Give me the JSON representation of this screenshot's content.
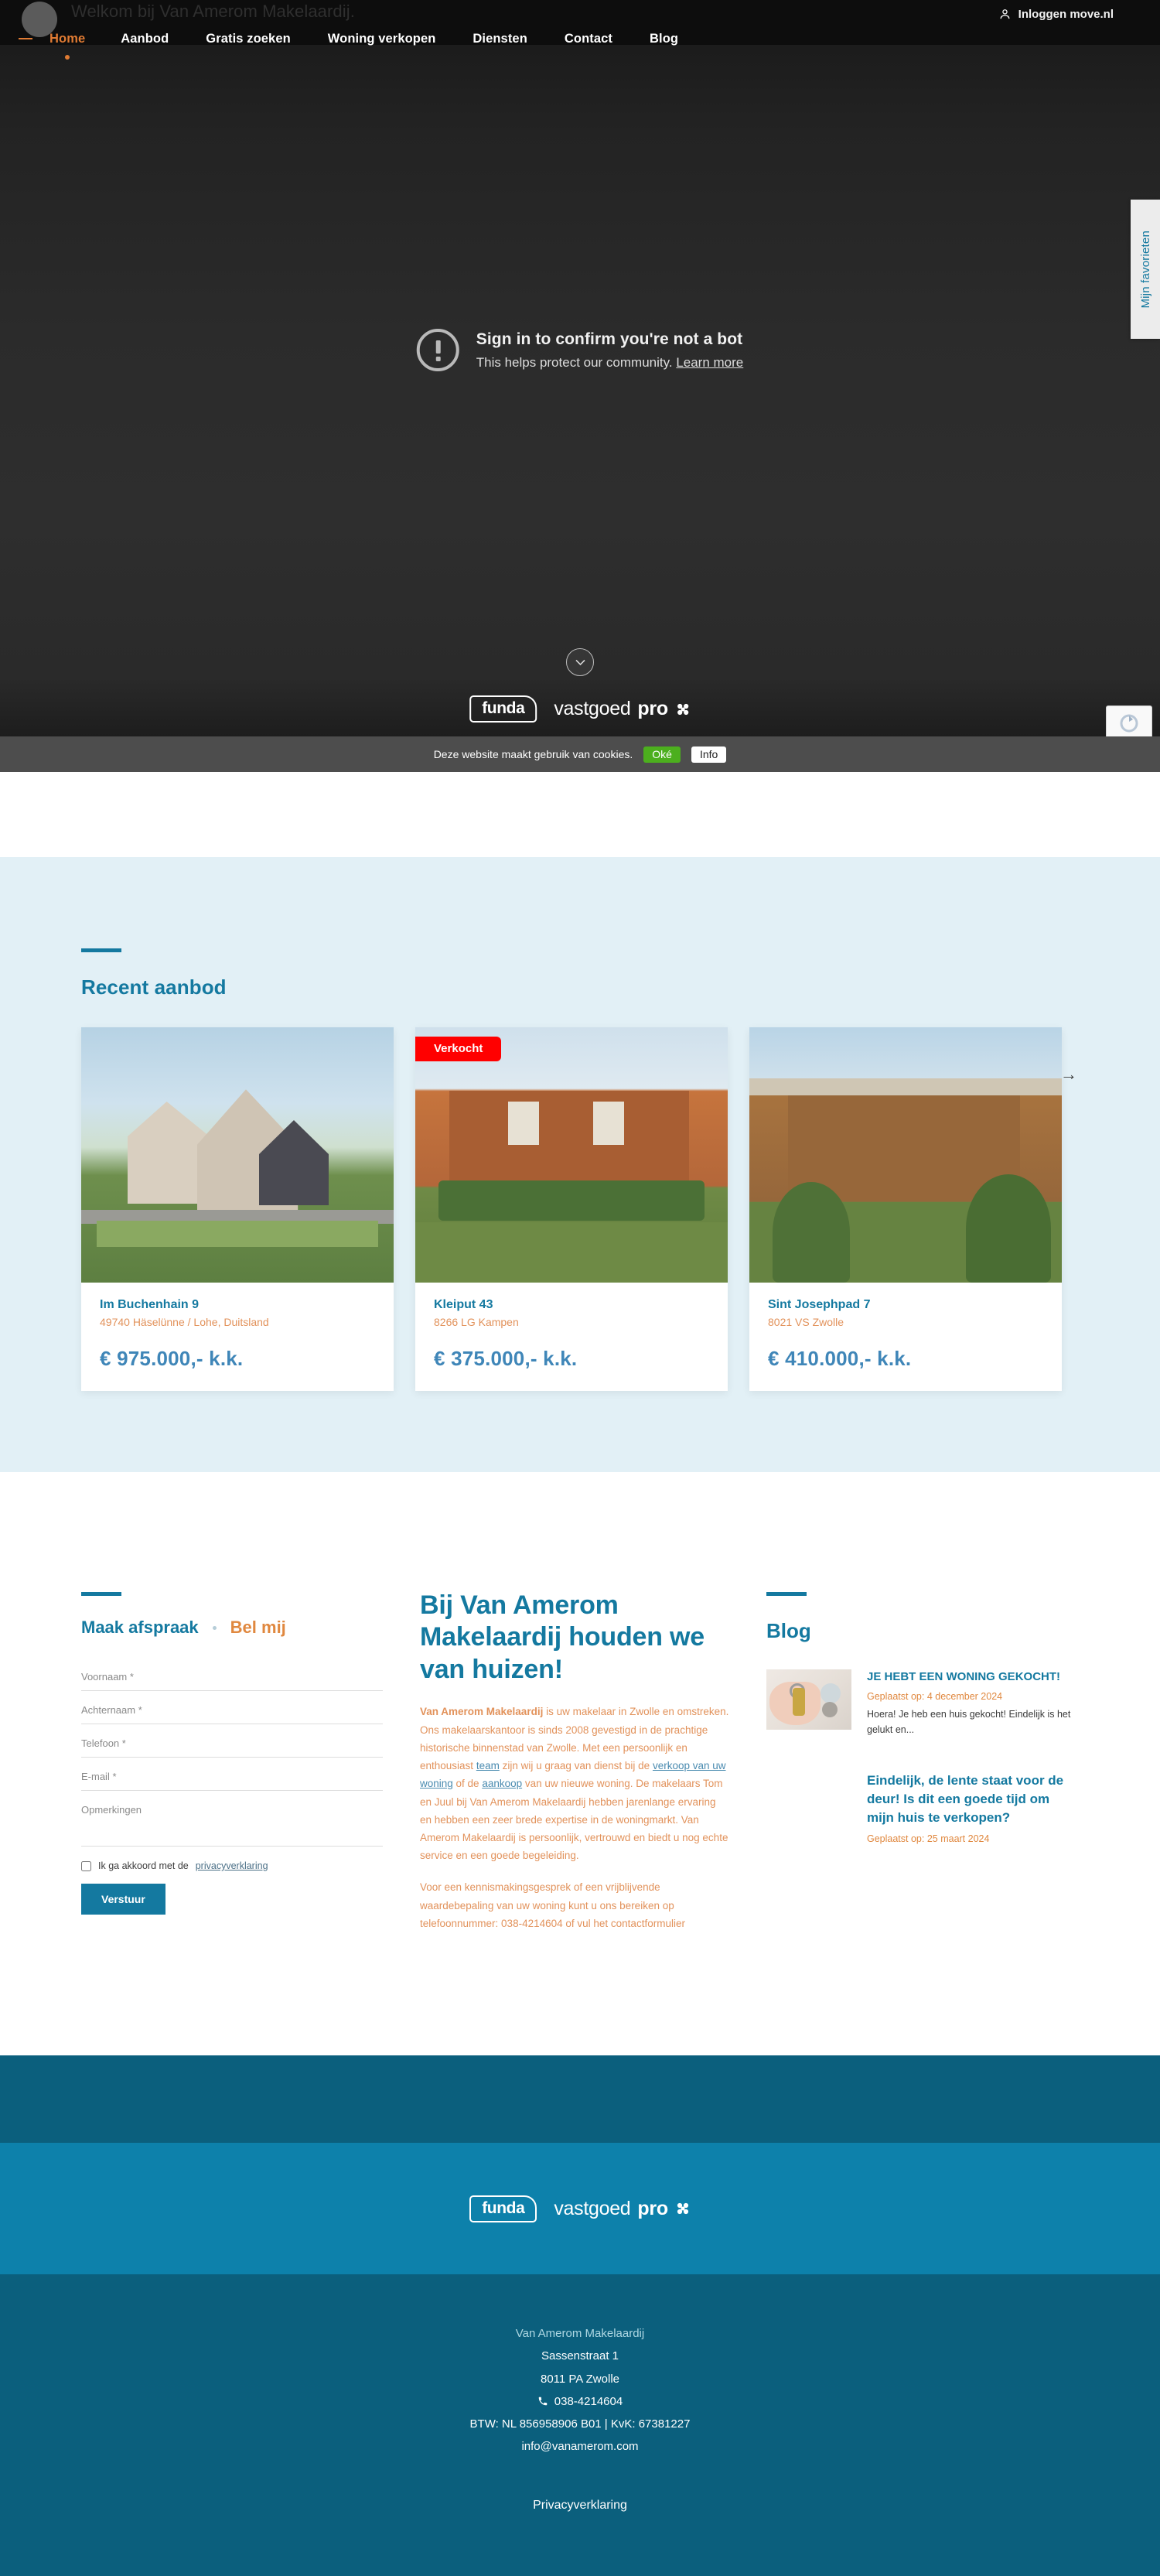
{
  "hero": {
    "welcome": "Welkom bij Van Amerom Makelaardij.",
    "login_label": "Inloggen move.nl",
    "bot_title": "Sign in to confirm you're not a bot",
    "bot_sub": "This helps protect our community.",
    "bot_link": "Learn more",
    "funda_label": "funda",
    "vastgoed_label": "vastgoed",
    "pro_label": "pro",
    "favorites_label": "Mijn favorieten"
  },
  "nav": {
    "items": [
      {
        "label": "Home",
        "active": true
      },
      {
        "label": "Aanbod",
        "active": false
      },
      {
        "label": "Gratis zoeken",
        "active": false
      },
      {
        "label": "Woning verkopen",
        "active": false
      },
      {
        "label": "Diensten",
        "active": false
      },
      {
        "label": "Contact",
        "active": false
      },
      {
        "label": "Blog",
        "active": false
      }
    ]
  },
  "cookiebar": {
    "text": "Deze website maakt gebruik van cookies.",
    "accept": "Oké",
    "info": "Info"
  },
  "recent": {
    "title": "Recent aanbod",
    "prev": "←",
    "next": "→",
    "cards": [
      {
        "address": "Im Buchenhain 9",
        "zip": "49740 Häselünne / Lohe, Duitsland",
        "price": "€ 975.000,- k.k.",
        "badge": ""
      },
      {
        "address": "Kleiput 43",
        "zip": "8266 LG Kampen",
        "price": "€ 375.000,- k.k.",
        "badge": "Verkocht"
      },
      {
        "address": "Sint Josephpad 7",
        "zip": "8021 VS Zwolle",
        "price": "€ 410.000,- k.k.",
        "badge": ""
      }
    ]
  },
  "form": {
    "tab_appointment": "Maak afspraak",
    "tab_call": "Bel mij",
    "fields": [
      {
        "placeholder": "Voornaam *",
        "value": ""
      },
      {
        "placeholder": "Achternaam *",
        "value": ""
      },
      {
        "placeholder": "Telefoon *",
        "value": ""
      },
      {
        "placeholder": "E-mail *",
        "value": ""
      }
    ],
    "comments_placeholder": "Opmerkingen",
    "consent_text": "Ik ga akkoord met de",
    "consent_link": "privacyverklaring",
    "submit": "Verstuur"
  },
  "about": {
    "heading": "Bij Van Amerom Makelaardij houden we van huizen!",
    "p1_strong": "Van Amerom Makelaardij",
    "p1_a": " is uw makelaar in Zwolle en omstreken. Ons makelaarskantoor is sinds 2008 gevestigd in de prachtige historische binnenstad van Zwolle. Met een persoonlijk en enthousiast ",
    "link_team": "team",
    "p1_b": " zijn wij u graag van dienst bij de ",
    "link_verkoop": "verkoop van uw woning",
    "p1_c": " of de ",
    "link_aankoop": "aankoop",
    "p1_d": " van uw nieuwe woning. De makelaars Tom en Juul bij Van Amerom Makelaardij hebben jarenlange ervaring en hebben een zeer brede expertise in de woningmarkt. Van Amerom Makelaardij is persoonlijk, vertrouwd en biedt u nog echte service en een goede begeleiding.",
    "p2": "Voor een kennismakingsgesprek of een vrijblijvende waardebepaling van uw woning kunt u ons bereiken op telefoonnummer: 038-4214604 of vul het contactformulier"
  },
  "blog": {
    "title": "Blog",
    "items": [
      {
        "title": "JE HEBT EEN WONING GEKOCHT!",
        "date": "Geplaatst op: 4 december 2024",
        "excerpt": "Hoera! Je heb een huis gekocht! Eindelijk is het gelukt en..."
      },
      {
        "title": "Eindelijk, de lente staat voor de deur! Is dit een goede tijd om mijn huis te verkopen?",
        "date": "Geplaatst op: 25 maart 2024",
        "excerpt": ""
      }
    ]
  },
  "footer": {
    "funda_label": "funda",
    "vastgoed_label": "vastgoed",
    "pro_label": "pro",
    "company": "Van Amerom Makelaardij",
    "street": "Sassenstraat 1",
    "city": "8011 PA Zwolle",
    "phone": "038-4214604",
    "registration": "BTW: NL 856958906 B01 | KvK: 67381227",
    "email": "info@vanamerom.com",
    "privacy": "Privacyverklaring"
  },
  "colors": {
    "brand_blue": "#1479a0",
    "brand_orange": "#e0883f",
    "sold_red": "#ff0000",
    "footer_dark": "#0b5f7d",
    "footer_mid": "#0d81ab",
    "section_bg": "#e2f0f6"
  }
}
